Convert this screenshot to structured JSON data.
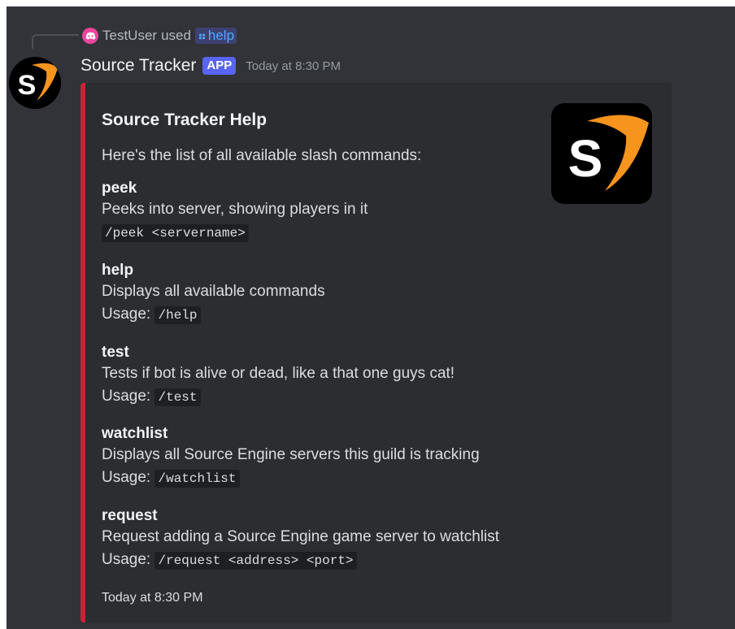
{
  "reply": {
    "user": "TestUser",
    "used_text": "used",
    "command": "help"
  },
  "message": {
    "author": "Source Tracker",
    "badge": "APP",
    "timestamp": "Today at 8:30 PM",
    "avatar_letter": "S"
  },
  "embed": {
    "accent_color": "#cc2236",
    "title": "Source Tracker Help",
    "description": "Here's the list of all available slash commands:",
    "thumbnail_letter": "S",
    "fields": [
      {
        "name": "peek",
        "description": "Peeks into server, showing players in it",
        "usage_label": "",
        "usage": "/peek <servername>"
      },
      {
        "name": "help",
        "description": "Displays all available commands",
        "usage_label": "Usage:",
        "usage": "/help"
      },
      {
        "name": "test",
        "description": "Tests if bot is alive or dead, like a that one guys cat!",
        "usage_label": "Usage:",
        "usage": "/test"
      },
      {
        "name": "watchlist",
        "description": "Displays all Source Engine servers this guild is tracking",
        "usage_label": "Usage:",
        "usage": "/watchlist"
      },
      {
        "name": "request",
        "description": "Request adding a Source Engine game server to watchlist",
        "usage_label": "Usage:",
        "usage": "/request <address> <port>"
      }
    ],
    "footer": "Today at 8:30 PM"
  }
}
